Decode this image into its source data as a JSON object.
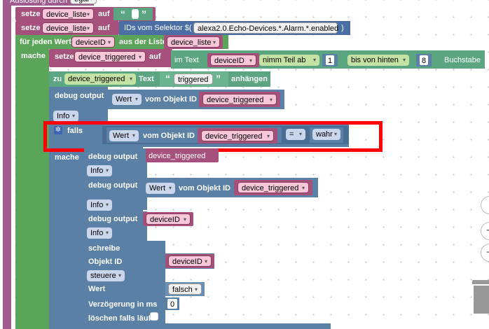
{
  "top_partial": "Auslösung durch ",
  "top_partial_value": "egal",
  "setze_label": "setze",
  "auf_label": "auf",
  "var_device_liste": "device_liste",
  "var_device_triggered": "device_triggered",
  "var_deviceID": "deviceID",
  "quote_open": "“",
  "quote_close": "”",
  "selector_label": "IDs vom Selektor $(",
  "selector_value": "alexa2.0.Echo-Devices.*.Alarm.*.enabled",
  "selector_close": ")",
  "for_each_label": "für jeden Wert",
  "from_list_label": "aus der Liste",
  "mache_label": "mache",
  "im_text_label": "im Text",
  "nimm_teil_label": "nimm Teil ab",
  "num_1": "1",
  "bis_von_hinten": "bis von hinten",
  "num_8": "8",
  "buchstabe_label": "Buchstabe",
  "zu_label": "zu",
  "text_label": "Text",
  "triggered_text": "triggered",
  "anhaengen_label": "anhängen",
  "debug_output_label": "debug output",
  "wert_label": "Wert",
  "vom_objekt_id_label": "vom Objekt ID",
  "info_label": "Info",
  "falls_label": "falls",
  "eq_op": "=",
  "wahr_label": "wahr",
  "schreibe_label": "schreibe",
  "objekt_id_label": "Objekt ID",
  "steuere_label": "steuere",
  "falsch_label": "falsch",
  "verzoegerung_label": "Verzögerung in ms",
  "num_0": "0",
  "loeschen_label": "löschen falls läuft",
  "caret": "▾",
  "zoom_in_icon": "+",
  "zoom_out_icon": "−"
}
